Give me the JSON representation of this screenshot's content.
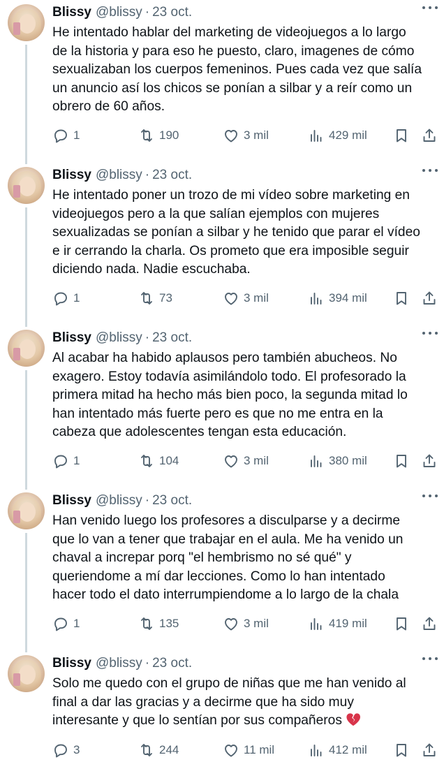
{
  "colors": {
    "text": "#0f1419",
    "secondary": "#536471",
    "thread_line": "#cfd9de",
    "heartbreak": "#e0245e"
  },
  "tweets": [
    {
      "name": "Blissy",
      "handle": "@blissy",
      "separator": "·",
      "date": "23 oct.",
      "text": "He intentado hablar del marketing de videojuegos a lo largo\nde la historia y para eso he puesto, claro, imagenes de cómo\nsexualizaban los cuerpos femeninos. Pues cada vez que salía\nun anuncio así los chicos se ponían a silbar y a reír como un\nobrero de 60 años.",
      "replies": "1",
      "retweets": "190",
      "likes": "3 mil",
      "views": "429 mil"
    },
    {
      "name": "Blissy",
      "handle": "@blissy",
      "separator": "·",
      "date": "23 oct.",
      "text": "He intentado poner un trozo de mi vídeo sobre marketing en\nvideojuegos pero a la que salían ejemplos con mujeres\nsexualizadas se ponían a silbar y he tenido que parar el vídeo\ne ir cerrando la charla. Os prometo que era imposible seguir\ndiciendo nada. Nadie escuchaba.",
      "replies": "1",
      "retweets": "73",
      "likes": "3 mil",
      "views": "394 mil"
    },
    {
      "name": "Blissy",
      "handle": "@blissy",
      "separator": "·",
      "date": "23 oct.",
      "text": "Al acabar ha habido aplausos pero también abucheos. No\nexagero. Estoy todavía asimilándolo todo. El profesorado la\nprimera mitad ha hecho más bien poco, la segunda mitad lo\nhan intentado más fuerte pero es que no me entra en la\ncabeza que adolescentes tengan esta educación.",
      "replies": "1",
      "retweets": "104",
      "likes": "3 mil",
      "views": "380 mil"
    },
    {
      "name": "Blissy",
      "handle": "@blissy",
      "separator": "·",
      "date": "23 oct.",
      "text": "Han venido luego los profesores a disculparse y a decirme\nque lo van a tener que trabajar en el aula. Me ha venido un\nchaval a increpar porq \"el hembrismo no sé qué\" y\nqueriendome a mí dar lecciones. Como lo han intentado\nhacer todo el dato interrumpiendome a lo largo de la chala",
      "replies": "1",
      "retweets": "135",
      "likes": "3 mil",
      "views": "419 mil"
    },
    {
      "name": "Blissy",
      "handle": "@blissy",
      "separator": "·",
      "date": "23 oct.",
      "text": "Solo me quedo con el grupo de niñas que me han venido al\nfinal a dar las gracias y a decirme que ha sido muy\ninteresante y que lo sentían por sus compañeros ",
      "emoji": "broken-heart-icon",
      "replies": "3",
      "retweets": "244",
      "likes": "11 mil",
      "views": "412 mil"
    }
  ]
}
